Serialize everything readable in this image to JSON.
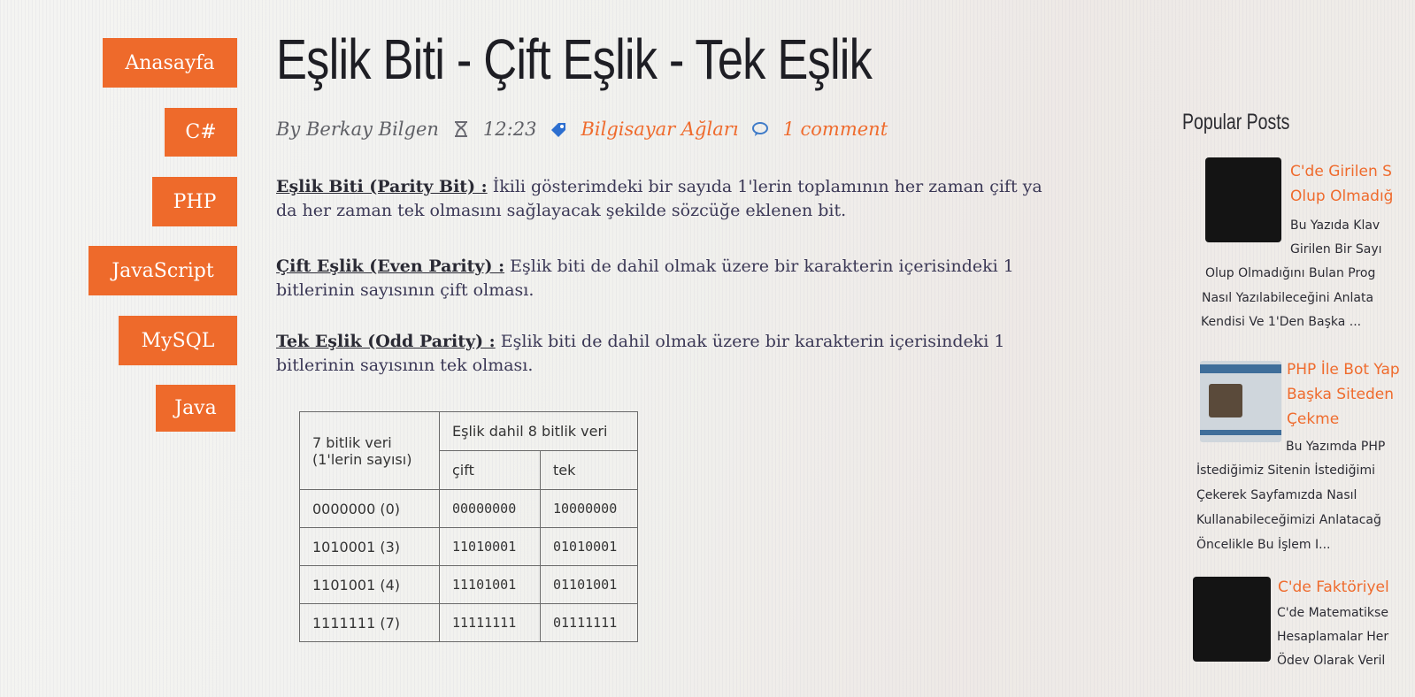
{
  "nav": {
    "items": [
      "Anasayfa",
      "C#",
      "PHP",
      "JavaScript",
      "MySQL",
      "Java"
    ]
  },
  "post": {
    "title": "Eşlik Biti - Çift Eşlik - Tek Eşlik",
    "author": "By Berkay Bilgen",
    "time": "12:23",
    "category": "Bilgisayar Ağları",
    "comments": "1 comment",
    "paragraphs": [
      {
        "term": "Eşlik Biti (Parity Bit) :",
        "text_line1": " İkili gösterimdeki bir sayıda 1'lerin toplamının her zaman çift ya",
        "text_line2": "da her zaman tek olmasını sağlayacak şekilde sözcüğe eklenen bit."
      },
      {
        "term": "Çift Eşlik (Even Parity) :",
        "text_line1": " Eşlik biti de dahil olmak üzere bir karakterin içerisindeki 1",
        "text_line2": "bitlerinin sayısının çift olması."
      },
      {
        "term": "Tek Eşlik (Odd Parity) :",
        "text_line1": " Eşlik biti de dahil olmak üzere bir karakterin içerisindeki 1",
        "text_line2": "bitlerinin sayısının tek olması."
      }
    ]
  },
  "table": {
    "header_col1_line1": "7 bitlik veri",
    "header_col1_line2": "(1'lerin sayısı)",
    "header_group": "Eşlik dahil 8 bitlik veri",
    "header_even": "çift",
    "header_odd": "tek",
    "rows": [
      {
        "data": "0000000 (0)",
        "even": "00000000",
        "odd": "10000000"
      },
      {
        "data": "1010001 (3)",
        "even": "11010001",
        "odd": "01010001"
      },
      {
        "data": "1101001 (4)",
        "even": "11101001",
        "odd": "01101001"
      },
      {
        "data": "1111111 (7)",
        "even": "11111111",
        "odd": "01111111"
      }
    ]
  },
  "sidebar": {
    "title": "Popular Posts",
    "posts": [
      {
        "title_lines": [
          "C'de Girilen S",
          "Olup Olmadığ"
        ],
        "excerpt_lines": [
          "Bu Yazıda Klav",
          "Girilen Bir Sayı",
          "Olup Olmadığını Bulan Prog",
          "Nasıl Yazılabileceğini Anlata",
          "Kendisi Ve 1'Den Başka ..."
        ]
      },
      {
        "title_lines": [
          "PHP İle Bot Yap",
          "Başka Siteden",
          "Çekme"
        ],
        "excerpt_lines": [
          "Bu Yazımda PHP",
          "İstediğimiz Sitenin İstediğimi",
          "Çekerek Sayfamızda Nasıl",
          "Kullanabileceğimizi Anlatacağ",
          "Öncelikle Bu İşlem I..."
        ]
      },
      {
        "title_lines": [
          "C'de Faktöriyel"
        ],
        "excerpt_lines": [
          "C'de Matematikse",
          "Hesaplamalar Her",
          "Ödev Olarak Veril"
        ]
      }
    ]
  },
  "colors": {
    "accent": "#ee6a2b",
    "text": "#3b3856"
  }
}
